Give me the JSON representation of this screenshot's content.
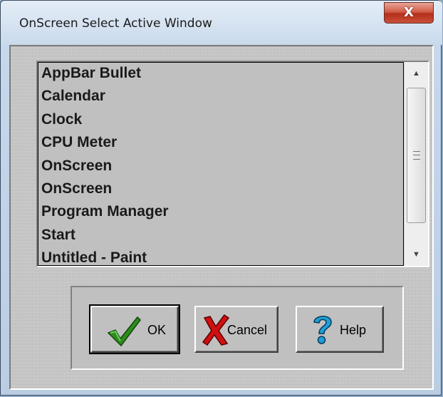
{
  "window": {
    "title": "OnScreen Select Active Window",
    "close_glyph": "X"
  },
  "listbox": {
    "items": [
      "AppBar Bullet",
      "Calendar",
      "Clock",
      "CPU Meter",
      "OnScreen",
      "OnScreen",
      "Program Manager",
      "Start",
      "Untitled - Paint"
    ],
    "scroll_up_glyph": "▲",
    "scroll_down_glyph": "▼"
  },
  "buttons": {
    "ok_label": "OK",
    "cancel_label": "Cancel",
    "help_label": "Help"
  },
  "icons": {
    "ok": "checkmark-icon",
    "cancel": "red-x-icon",
    "help": "question-mark-icon"
  },
  "colors": {
    "face": "#c0c0c0",
    "check": "#2e8b1e",
    "cancel_x": "#d01010",
    "help_q": "#1e9fd8"
  }
}
